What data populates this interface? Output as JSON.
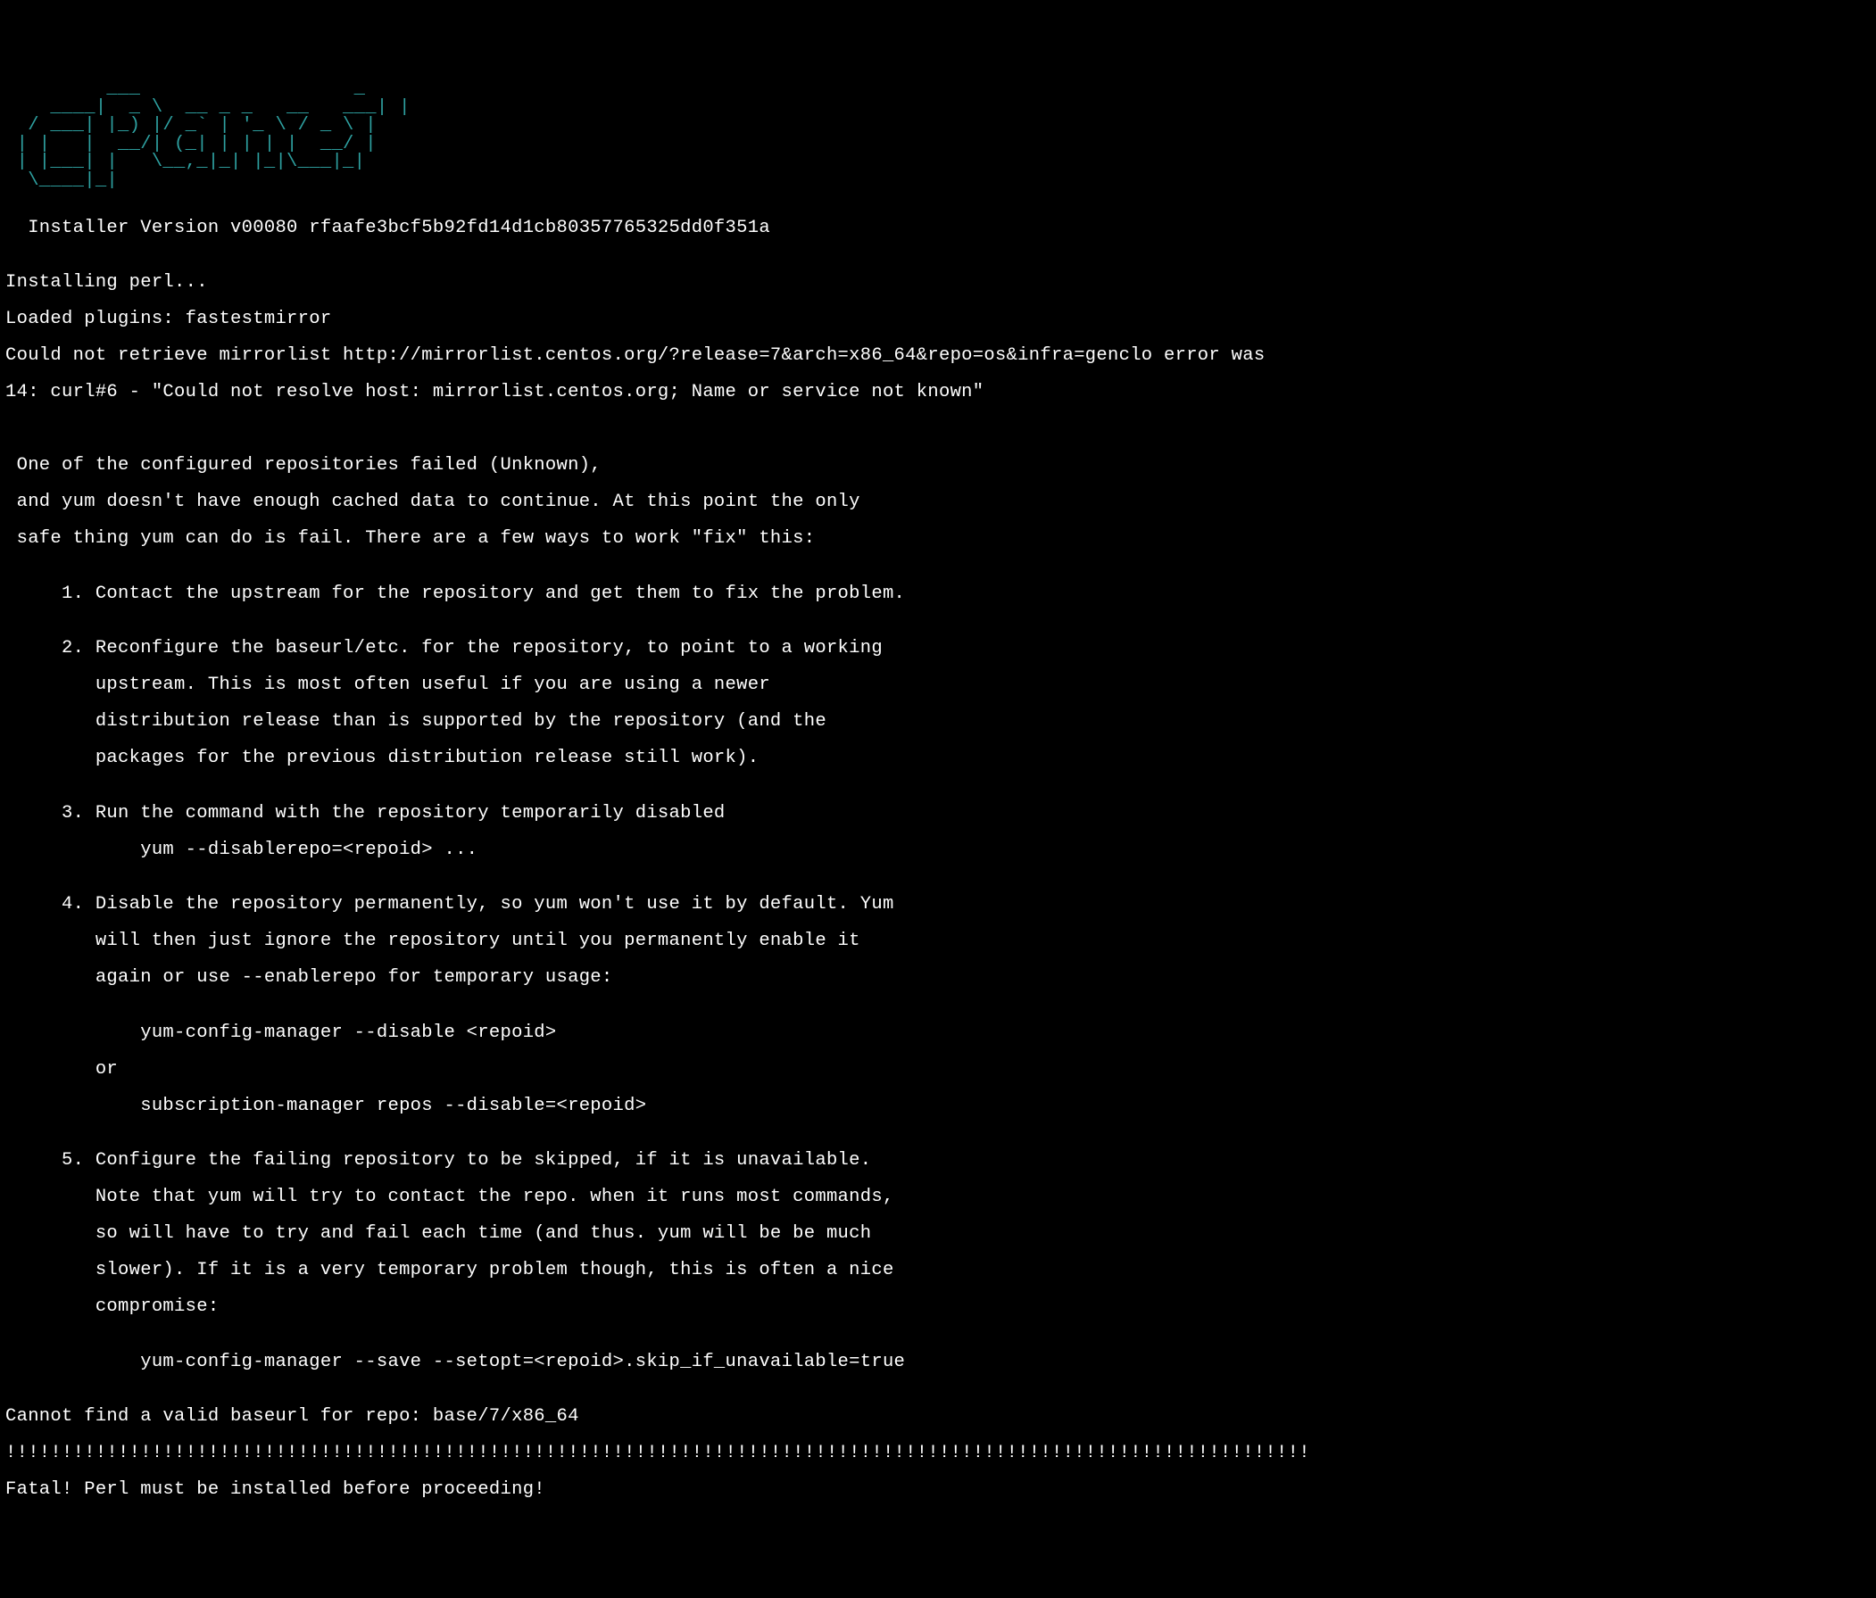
{
  "logo": {
    "line1": "   ____                  __",
    "line2": "  / ___| _ __   __ _ _ __   ___| |",
    "line3": " | |   | '_ \\ / _` | '_ \\ / _ \\ |",
    "line4": " | |___| |_) | (_| | | | |  __/ |",
    "line5": "  \\____| .__/ \\__,_|_| |_|\\___|_|",
    "line6": "       |_|"
  },
  "terminal": {
    "installer_line": "  Installer Version v00080 rfaafe3bcf5b92fd14d1cb80357765325dd0f351a",
    "blank1": "",
    "installing_perl": "Installing perl...",
    "loaded_plugins": "Loaded plugins: fastestmirror",
    "mirrorlist_error": "Could not retrieve mirrorlist http://mirrorlist.centos.org/?release=7&arch=x86_64&repo=os&infra=genclo error was",
    "curl_error": "14: curl#6 - \"Could not resolve host: mirrorlist.centos.org; Name or service not known\"",
    "blank2": "",
    "blank3": "",
    "repo_failed": " One of the configured repositories failed (Unknown),",
    "yum_cached": " and yum doesn't have enough cached data to continue. At this point the only",
    "yum_fail": " safe thing yum can do is fail. There are a few ways to work \"fix\" this:",
    "blank4": "",
    "option1": "     1. Contact the upstream for the repository and get them to fix the problem.",
    "blank5": "",
    "option2_l1": "     2. Reconfigure the baseurl/etc. for the repository, to point to a working",
    "option2_l2": "        upstream. This is most often useful if you are using a newer",
    "option2_l3": "        distribution release than is supported by the repository (and the",
    "option2_l4": "        packages for the previous distribution release still work).",
    "blank6": "",
    "option3_l1": "     3. Run the command with the repository temporarily disabled",
    "option3_l2": "            yum --disablerepo=<repoid> ...",
    "blank7": "",
    "option4_l1": "     4. Disable the repository permanently, so yum won't use it by default. Yum",
    "option4_l2": "        will then just ignore the repository until you permanently enable it",
    "option4_l3": "        again or use --enablerepo for temporary usage:",
    "blank8": "",
    "option4_cmd1": "            yum-config-manager --disable <repoid>",
    "option4_or": "        or",
    "option4_cmd2": "            subscription-manager repos --disable=<repoid>",
    "blank9": "",
    "option5_l1": "     5. Configure the failing repository to be skipped, if it is unavailable.",
    "option5_l2": "        Note that yum will try to contact the repo. when it runs most commands,",
    "option5_l3": "        so will have to try and fail each time (and thus. yum will be be much",
    "option5_l4": "        slower). If it is a very temporary problem though, this is often a nice",
    "option5_l5": "        compromise:",
    "blank10": "",
    "option5_cmd": "            yum-config-manager --save --setopt=<repoid>.skip_if_unavailable=true",
    "blank11": "",
    "cannot_find": "Cannot find a valid baseurl for repo: base/7/x86_64",
    "bang_line": "!!!!!!!!!!!!!!!!!!!!!!!!!!!!!!!!!!!!!!!!!!!!!!!!!!!!!!!!!!!!!!!!!!!!!!!!!!!!!!!!!!!!!!!!!!!!!!!!!!!!!!!!!!!!!!!!!!!!",
    "fatal": "Fatal! Perl must be installed before proceeding!"
  }
}
